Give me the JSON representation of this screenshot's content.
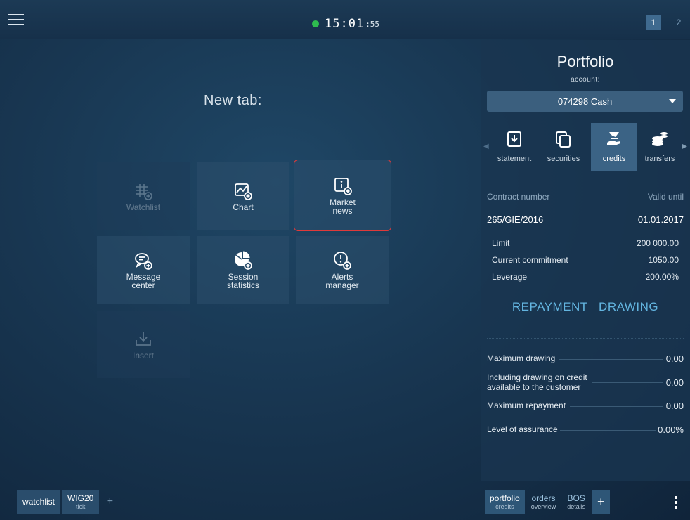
{
  "topbar": {
    "time_hm": "15:01",
    "time_sec": ":55",
    "workspaces": [
      "1",
      "2"
    ],
    "status_color": "#2ebc4f"
  },
  "newtab": {
    "title": "New tab:",
    "tiles": [
      {
        "label": "Watchlist",
        "icon": "watchlist-add-icon",
        "enabled": false
      },
      {
        "label": "Chart",
        "icon": "chart-add-icon",
        "enabled": true
      },
      {
        "label_line1": "Market",
        "label_line2": "news",
        "icon": "info-add-icon",
        "enabled": true,
        "selected": true
      },
      {
        "label_line1": "Message",
        "label_line2": "center",
        "icon": "message-add-icon",
        "enabled": true
      },
      {
        "label_line1": "Session",
        "label_line2": "statistics",
        "icon": "pie-add-icon",
        "enabled": true
      },
      {
        "label_line1": "Alerts",
        "label_line2": "manager",
        "icon": "alert-add-icon",
        "enabled": true
      },
      {
        "label": "Insert",
        "icon": "download-tray-icon",
        "enabled": false
      }
    ]
  },
  "bottom_left_tabs": [
    {
      "main": "watchlist",
      "sub": ""
    },
    {
      "main": "WIG20",
      "sub": "tick"
    }
  ],
  "portfolio": {
    "title": "Portfolio",
    "account_label": "account:",
    "account_value": "074298 Cash",
    "sections": [
      {
        "label": "statement",
        "icon": "statement-icon"
      },
      {
        "label": "securities",
        "icon": "securities-icon"
      },
      {
        "label": "credits",
        "icon": "credits-hand-icon",
        "active": true
      },
      {
        "label": "transfers",
        "icon": "coins-icon"
      }
    ],
    "table_header": {
      "left": "Contract number",
      "right": "Valid until"
    },
    "contract": {
      "number": "265/GIE/2016",
      "valid_until": "01.01.2017"
    },
    "details": [
      {
        "label": "Limit",
        "value": "200 000.00"
      },
      {
        "label": "Current commitment",
        "value": "1050.00"
      },
      {
        "label": "Leverage",
        "value": "200.00%"
      }
    ],
    "actions": {
      "repayment": "REPAYMENT",
      "drawing": "DRAWING"
    },
    "summary": [
      {
        "label": "Maximum drawing",
        "value": "0.00"
      },
      {
        "label_line1": "Including drawing on credit",
        "label_line2": "available to the customer",
        "value": "0.00"
      },
      {
        "label": "Maximum repayment",
        "value": "0.00"
      },
      {
        "label": "Level of assurance",
        "value": "0.00%"
      }
    ]
  },
  "bottom_right_tabs": [
    {
      "main": "portfolio",
      "sub": "credits"
    },
    {
      "main": "orders",
      "sub": "overview"
    },
    {
      "main": "BOS",
      "sub": "details"
    }
  ],
  "colors": {
    "accent": "#63b5e0",
    "selected_outline": "#e03a3a",
    "active_tab": "#3b6385"
  }
}
